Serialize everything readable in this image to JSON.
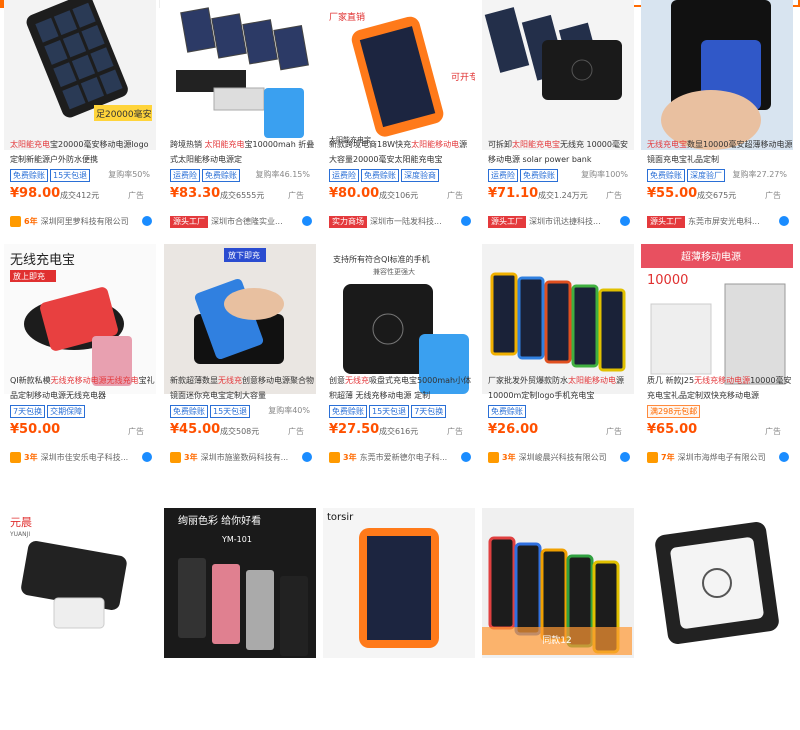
{
  "search": {
    "placeholder": ""
  },
  "overlay_label": "同款12",
  "rows": [
    [
      {
        "title_pre": "",
        "title_hl": "太阳能充电",
        "title_post": "宝20000毫安移动电源logo定制新能源户外防水便携",
        "tags": [
          "免费赊账",
          "15天包退"
        ],
        "rate": "复购率50%",
        "price": "¥98.00",
        "sales": "成交412元",
        "ad": "广告",
        "year": "6年",
        "store_badge": "",
        "store": "深圳阿里萝科技有限公司"
      },
      {
        "title_pre": "跨境热销 ",
        "title_hl": "太阳能充电",
        "title_post": "宝10000mah 折叠式太阳能移动电源定",
        "tags": [
          "运费险",
          "免费赊账"
        ],
        "rate": "复购率46.15%",
        "price": "¥83.30",
        "sales": "成交6555元",
        "ad": "广告",
        "year": "",
        "store_badge": "源头工厂",
        "store": "深圳市合德隆实业..."
      },
      {
        "title_pre": "新款跨境电商18W快充",
        "title_hl": "太阳能移动电",
        "title_post": "源大容量20000毫安太阳能充电宝",
        "tags": [
          "运费险",
          "免费赊账",
          "深度验商"
        ],
        "rate": "",
        "price": "¥80.00",
        "sales": "成交106元",
        "ad": "广告",
        "year": "",
        "store_badge": "实力商场",
        "store": "深圳市一陆发科技..."
      },
      {
        "title_pre": "可拆卸",
        "title_hl": "太阳能充电宝",
        "title_post": "无线充 10000毫安移动电源 solar power bank",
        "tags": [
          "运费险",
          "免费赊账"
        ],
        "rate": "复购率100%",
        "price": "¥71.10",
        "sales": "成交1.24万元",
        "ad": "广告",
        "year": "",
        "store_badge": "源头工厂",
        "store": "深圳市讯达捷科技..."
      },
      {
        "title_pre": "",
        "title_hl": "无线充电宝",
        "title_post": "数显10000毫安超薄移动电源镜面充电宝礼品定制",
        "tags": [
          "免费赊账",
          "深度验厂"
        ],
        "rate": "复购率27.27%",
        "price": "¥55.00",
        "sales": "成交675元",
        "ad": "广告",
        "year": "",
        "store_badge": "源头工厂",
        "store": "东莞市屏安光电科..."
      }
    ],
    [
      {
        "title_pre": "QI新款私模",
        "title_hl": "无线充移动电源无线充电",
        "title_post": "宝礼品定制移动电源无线充电器",
        "tags": [
          "7天包换",
          "交期保障"
        ],
        "rate": "",
        "price": "¥50.00",
        "sales": "",
        "ad": "广告",
        "year": "3年",
        "store_badge": "",
        "store": "深圳市佳安乐电子科技..."
      },
      {
        "title_pre": "新款超薄数显",
        "title_hl": "无线充",
        "title_post": "创意移动电源聚合物镜面迷你充电宝定制大容量",
        "tags": [
          "免费赊账",
          "15天包退"
        ],
        "rate": "复购率40%",
        "price": "¥45.00",
        "sales": "成交508元",
        "ad": "广告",
        "year": "3年",
        "store_badge": "",
        "store": "深圳市施鉴数码科技有..."
      },
      {
        "title_pre": "创意",
        "title_hl": "无线充",
        "title_post": "吸盘式充电宝5000mah小体积超薄 无线充移动电源 定制",
        "tags": [
          "免费赊账",
          "15天包退",
          "7天包换"
        ],
        "rate": "",
        "price": "¥27.50",
        "sales": "成交616元",
        "ad": "广告",
        "year": "3年",
        "store_badge": "",
        "store": "东莞市爱新德尔电子科..."
      },
      {
        "title_pre": "厂家批发外贸爆款防水",
        "title_hl": "太阳能移动电",
        "title_post": "源10000m定制logo手机充电宝",
        "tags": [
          "免费赊账"
        ],
        "rate": "",
        "price": "¥26.00",
        "sales": "",
        "ad": "广告",
        "year": "3年",
        "store_badge": "",
        "store": "深圳峻晨兴科技有限公司"
      },
      {
        "title_pre": "质几 新款J25",
        "title_hl": "无线充移动电源",
        "title_post": "10000毫安充电宝礼品定制双快充移动电源",
        "tags": [
          "满298元包邮"
        ],
        "rate": "",
        "price": "¥65.00",
        "sales": "",
        "ad": "广告",
        "year": "7年",
        "store_badge": "",
        "store": "深圳市海烨电子有限公司"
      }
    ]
  ],
  "img_text": {
    "r1c1": "足20000毫安",
    "r1c3a": "厂家直销",
    "r1c3b": "可开专票",
    "r1c3c": "太阳能充电宝",
    "r2c1a": "无线充电宝",
    "r2c1b": "放上即充",
    "r2c2": "放下即充",
    "r2c3a": "支持所有符合QI标准的手机",
    "r2c3b": "兼容性更强大",
    "r2c5a": "超薄移动电源",
    "r2c5b": "10000",
    "r3c1a": "元晨",
    "r3c1b": "YUANJI",
    "r3c2a": "绚丽色彩 给你好看",
    "r3c2b": "YM-101",
    "r3c3": "torsir"
  }
}
